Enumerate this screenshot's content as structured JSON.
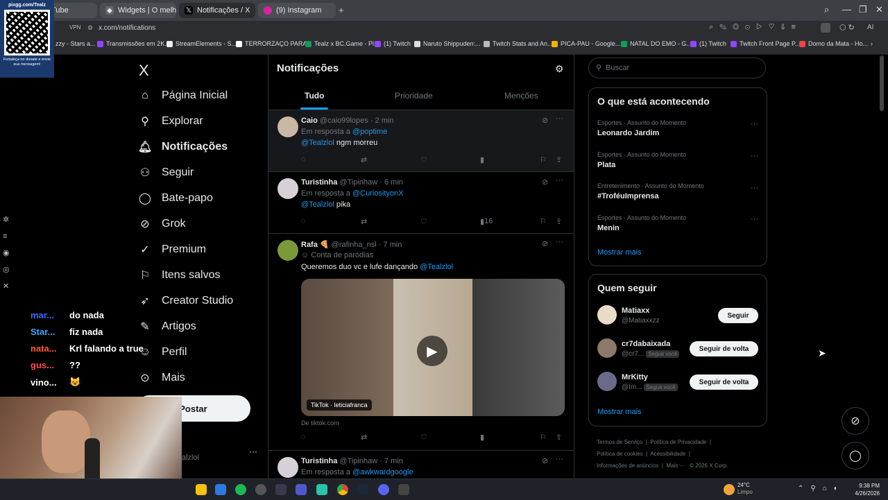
{
  "browser": {
    "tabs": [
      {
        "label": "uTube",
        "active": false
      },
      {
        "label": "Widgets | O melhor soft",
        "active": false
      },
      {
        "label": "Notificações / X",
        "active": true
      },
      {
        "label": "(9) Instagram",
        "active": false
      }
    ],
    "new_tab": "+",
    "vpn": "VPN",
    "url": "x.com/notifications",
    "bookmarks": [
      "zzy - Stars a...",
      "Transmissões em 2K...",
      "StreamElements - S...",
      "TERRORZAÇO PARA...",
      "Tealz x BC.Game - Pl...",
      "(1) Twitch",
      "Naruto Shippuden:...",
      "Twitch Stats and An...",
      "PICA-PAU - Google...",
      "NATAL DO EMO - G...",
      "(1) Twitch",
      "Twitch Front Page P...",
      "Domo da Mata - Ho..."
    ]
  },
  "qr_overlay": {
    "top": "pixgg.com/Tealz",
    "caption": "Fortaleça no donate e envie sua mensagem!"
  },
  "nav": {
    "logo": "X",
    "items": [
      {
        "label": "Página Inicial",
        "icon": "home-icon"
      },
      {
        "label": "Explorar",
        "icon": "search-icon"
      },
      {
        "label": "Notificações",
        "icon": "bell-icon"
      },
      {
        "label": "Seguir",
        "icon": "person-add-icon"
      },
      {
        "label": "Bate-papo",
        "icon": "chat-icon"
      },
      {
        "label": "Grok",
        "icon": "grok-icon"
      },
      {
        "label": "Premium",
        "icon": "verified-icon"
      },
      {
        "label": "Itens salvos",
        "icon": "bookmark-icon"
      },
      {
        "label": "Creator Studio",
        "icon": "rocket-icon"
      },
      {
        "label": "Artigos",
        "icon": "article-icon"
      },
      {
        "label": "Perfil",
        "icon": "profile-icon"
      },
      {
        "label": "Mais",
        "icon": "more-circle-icon"
      }
    ],
    "post_button": "Postar",
    "account_handle": "alzlol"
  },
  "main": {
    "title": "Notificações",
    "tabs": [
      "Tudo",
      "Prioridade",
      "Menções"
    ],
    "posts": [
      {
        "name": "Caio",
        "handle": "@caio99lopes · 2 min",
        "reply_prefix": "Em resposta a",
        "reply_to": "@poptime",
        "mention": "@Tealzlol",
        "text": "ngm morreu",
        "views": ""
      },
      {
        "name": "Turistinha",
        "handle": "@Tipinhaw · 6 min",
        "reply_prefix": "Em resposta a",
        "reply_to": "@CuriosityonX",
        "mention": "@Tealzlol",
        "text": "pika",
        "views": "16"
      },
      {
        "name": "Rafa 🍕",
        "handle": "@rafinha_nsl · 7 min",
        "parody": "Conta de paródias",
        "text": "Queremos duo vc e lufe dançando",
        "mention": "@Tealzlol",
        "video_label": "TikTok · leticiafranca",
        "source": "De tiktok.com"
      },
      {
        "name": "Turistinha",
        "handle": "@Tipinhaw · 7 min",
        "reply_prefix": "Em resposta a",
        "reply_to": "@awkwardgoogle"
      }
    ]
  },
  "right": {
    "search_placeholder": "Buscar",
    "trends_title": "O que está acontecendo",
    "trends": [
      {
        "meta": "Esportes · Assunto do Momento",
        "title": "Leonardo Jardim"
      },
      {
        "meta": "Esportes · Assunto do Momento",
        "title": "Plata"
      },
      {
        "meta": "Entretenimento · Assunto do Momento",
        "title": "#TroféuImprensa"
      },
      {
        "meta": "Esportes · Assunto do Momento",
        "title": "Menin"
      }
    ],
    "show_more": "Mostrar mais",
    "follow_title": "Quem seguir",
    "follow": [
      {
        "name": "Matiaxx",
        "handle": "@Matiaxxzz",
        "badge": "",
        "button": "Seguir"
      },
      {
        "name": "cr7dabaixada",
        "handle": "@cr7...",
        "badge": "Segue você",
        "button": "Seguir de volta"
      },
      {
        "name": "MrKitty",
        "handle": "@Im...",
        "badge": "Segue você",
        "button": "Seguir de volta"
      }
    ],
    "footer": [
      "Termos de Serviço",
      "Política de Privacidade",
      "Política de cookies",
      "Acessibilidade",
      "Informações de anúncios",
      "Mais ···",
      "© 2026 X Corp."
    ]
  },
  "chat": [
    {
      "user": "mar...",
      "msg": "do nada",
      "color": "#3b6cff"
    },
    {
      "user": "Star...",
      "msg": "fiz nada",
      "color": "#3fa7ff"
    },
    {
      "user": "nata...",
      "msg": "Krl falando a true",
      "color": "#ff5a3c"
    },
    {
      "user": "gus...",
      "msg": "??",
      "color": "#ff4a4a"
    },
    {
      "user": "vino...",
      "msg": "😺",
      "color": "#ffffff"
    }
  ],
  "taskbar": {
    "weather_temp": "24°C",
    "weather_desc": "Limpo",
    "time": "9:38 PM",
    "date": "4/26/2026"
  }
}
